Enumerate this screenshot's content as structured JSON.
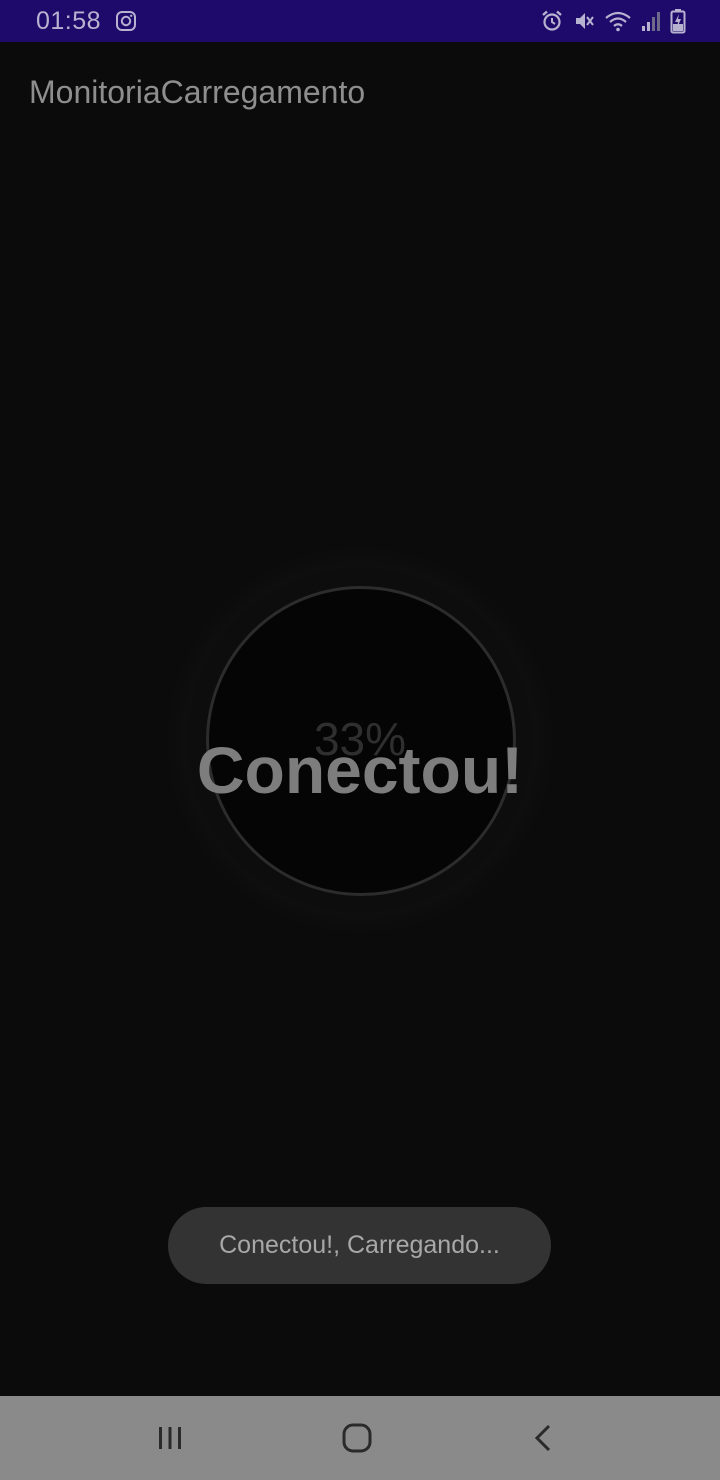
{
  "status_bar": {
    "time": "01:58",
    "background": "#1e0a6b",
    "left_icons": [
      "instagram-icon"
    ],
    "right_icons": [
      "alarm-icon",
      "mute-icon",
      "wifi-icon",
      "signal-icon",
      "battery-charging-icon"
    ]
  },
  "app_bar": {
    "title": "MonitoriaCarregamento"
  },
  "charging": {
    "percent_label": "33%",
    "progress": 0.33,
    "status_text": "Conectou!"
  },
  "toast": {
    "message": "Conectou!, Carregando..."
  },
  "nav_bar": {
    "background": "#8a8a8a",
    "buttons": [
      "recent-apps-icon",
      "home-icon",
      "back-icon"
    ]
  }
}
